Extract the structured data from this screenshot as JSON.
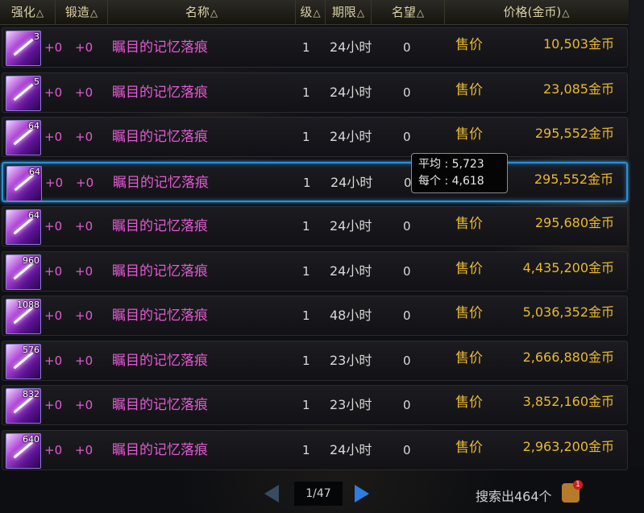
{
  "header": {
    "columns": [
      {
        "label": "强化",
        "arrow": "△"
      },
      {
        "label": "锻造",
        "arrow": "△"
      },
      {
        "label": "名称",
        "arrow": "△"
      },
      {
        "label": "级",
        "arrow": "△"
      },
      {
        "label": "期限",
        "arrow": "△"
      },
      {
        "label": "名望",
        "arrow": "△"
      },
      {
        "label": "价格(金币)",
        "arrow": "△"
      }
    ]
  },
  "rows": [
    {
      "qty": "3",
      "enhance": "+0",
      "forge": "+0",
      "name": "瞩目的记忆落痕",
      "level": "1",
      "duration": "24小时",
      "fame": "0",
      "sale": "售价",
      "price": "10,503金币"
    },
    {
      "qty": "5",
      "enhance": "+0",
      "forge": "+0",
      "name": "瞩目的记忆落痕",
      "level": "1",
      "duration": "24小时",
      "fame": "0",
      "sale": "售价",
      "price": "23,085金币"
    },
    {
      "qty": "64",
      "enhance": "+0",
      "forge": "+0",
      "name": "瞩目的记忆落痕",
      "level": "1",
      "duration": "24小时",
      "fame": "0",
      "sale": "售价",
      "price": "295,552金币"
    },
    {
      "qty": "64",
      "enhance": "+0",
      "forge": "+0",
      "name": "瞩目的记忆落痕",
      "level": "1",
      "duration": "24小时",
      "fame": "0",
      "sale": "售价",
      "price": "295,552金币",
      "selected": true
    },
    {
      "qty": "64",
      "enhance": "+0",
      "forge": "+0",
      "name": "瞩目的记忆落痕",
      "level": "1",
      "duration": "24小时",
      "fame": "0",
      "sale": "售价",
      "price": "295,680金币"
    },
    {
      "qty": "960",
      "enhance": "+0",
      "forge": "+0",
      "name": "瞩目的记忆落痕",
      "level": "1",
      "duration": "24小时",
      "fame": "0",
      "sale": "售价",
      "price": "4,435,200金币"
    },
    {
      "qty": "1088",
      "enhance": "+0",
      "forge": "+0",
      "name": "瞩目的记忆落痕",
      "level": "1",
      "duration": "48小时",
      "fame": "0",
      "sale": "售价",
      "price": "5,036,352金币"
    },
    {
      "qty": "576",
      "enhance": "+0",
      "forge": "+0",
      "name": "瞩目的记忆落痕",
      "level": "1",
      "duration": "23小时",
      "fame": "0",
      "sale": "售价",
      "price": "2,666,880金币"
    },
    {
      "qty": "832",
      "enhance": "+0",
      "forge": "+0",
      "name": "瞩目的记忆落痕",
      "level": "1",
      "duration": "23小时",
      "fame": "0",
      "sale": "售价",
      "price": "3,852,160金币"
    },
    {
      "qty": "640",
      "enhance": "+0",
      "forge": "+0",
      "name": "瞩目的记忆落痕",
      "level": "1",
      "duration": "24小时",
      "fame": "0",
      "sale": "售价",
      "price": "2,963,200金币"
    }
  ],
  "tooltip": {
    "avg": "平均 : 5,723",
    "each": "每个 : 4,618"
  },
  "pager": {
    "page": "1/47"
  },
  "footer": {
    "result": "搜索出464个",
    "badge": "1"
  },
  "colors": {
    "name": "#e35ad2",
    "price": "#e9b830",
    "selected_border": "#2a8fd6"
  }
}
